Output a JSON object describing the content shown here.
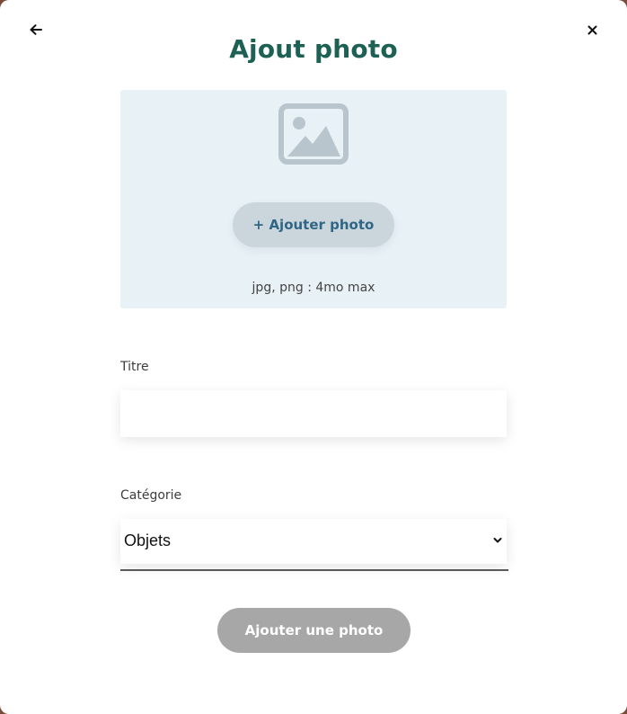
{
  "modal": {
    "title": "Ajout photo",
    "back_icon": "arrow-left-icon",
    "close_icon": "close-icon"
  },
  "upload": {
    "placeholder_icon": "picture-icon",
    "button_label": "+ Ajouter photo",
    "hint": "jpg, png : 4mo max"
  },
  "form": {
    "title_label": "Titre",
    "title_value": "",
    "category_label": "Catégorie",
    "category_selected": "Objets",
    "submit_label": "Ajouter une photo"
  },
  "colors": {
    "title": "#1d6154",
    "upload_bg": "#e8f1f6",
    "upload_button_bg": "#cbd6dc",
    "upload_button_text": "#306685",
    "submit_disabled_bg": "#a7a7a7"
  }
}
